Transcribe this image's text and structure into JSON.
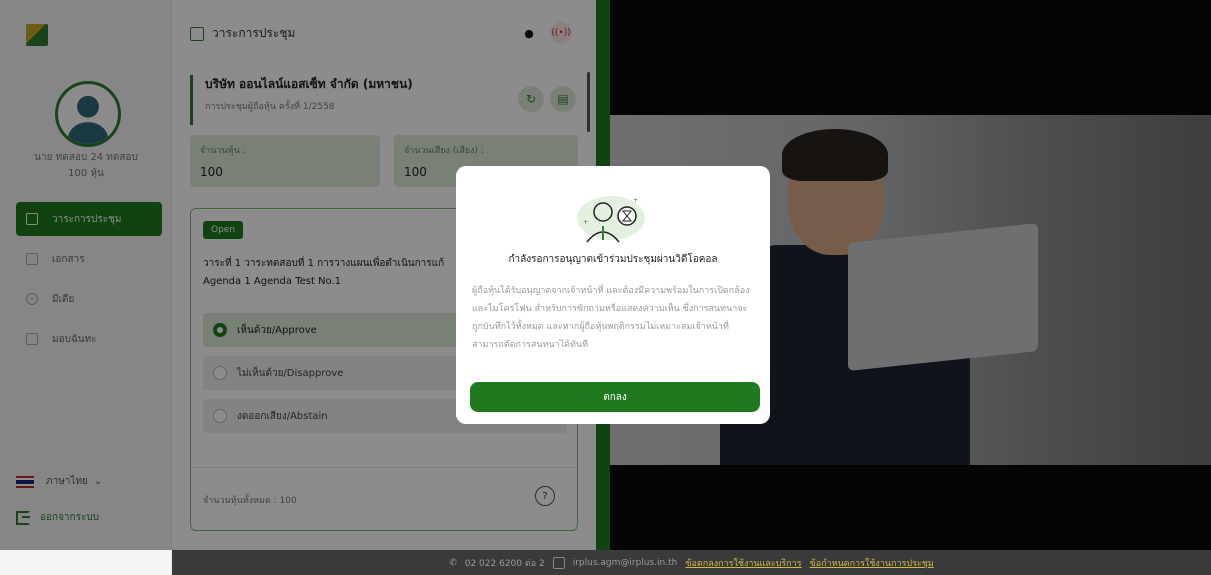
{
  "sidebar": {
    "user_name": "นาย ทดสอบ 24 ทดสอบ",
    "user_shares": "100 หุ้น",
    "nav": [
      {
        "label": "วาระการประชุม",
        "icon": "agenda-icon",
        "active": true
      },
      {
        "label": "เอกสาร",
        "icon": "document-icon",
        "active": false
      },
      {
        "label": "มีเดีย",
        "icon": "media-icon",
        "active": false
      },
      {
        "label": "มอบฉันทะ",
        "icon": "proxy-icon",
        "active": false
      }
    ],
    "language": "ภาษาไทย",
    "logout": "ออกจากระบบ"
  },
  "center": {
    "header_title": "วาระการประชุม",
    "company_name": "บริษัท ออนไลน์แอสเซ็ท จำกัด (มหาชน)",
    "meeting_subtitle": "การประชุมผู้ถือหุ้น ครั้งที่ 1/2558",
    "stats": [
      {
        "label": "จำนวนหุ้น :",
        "value": "100"
      },
      {
        "label": "จำนวนเสียง (เสียง) :",
        "value": "100"
      }
    ],
    "agenda": {
      "status": "Open",
      "title_th": "วาระที่ 1 วาระทดสอบที่ 1 การวางแผนเพื่อดำเนินการแก้",
      "title_en": "Agenda 1 Agenda Test No.1",
      "options": [
        {
          "label": "เห็นด้วย/Approve",
          "selected": true
        },
        {
          "label": "ไม่เห็นด้วย/Disapprove",
          "selected": false
        },
        {
          "label": "งดออกเสียง/Abstain",
          "selected": false
        }
      ],
      "total_shares": "จำนวนหุ้นทั้งหมด : 100"
    }
  },
  "modal": {
    "title": "กำลังรอการอนุญาตเข้าร่วมประชุมผ่านวิดีโอคอล",
    "body": "ผู้ถือหุ้นได้รับอนุญาตจากเจ้าหน้าที่ และต้องมีความพร้อมในการเปิดกล้องและไมโครโฟน สำหรับการซักถามหรือแสดงความเห็น ซึ่งการสนทนาจะถูกบันทึกไว้ทั้งหมด และหากผู้ถือหุ้นพฤติกรรมไม่เหมาะสมเจ้าหน้าที่สามารถตัดการสนทนาได้ทันที",
    "button": "ตกลง"
  },
  "footer": {
    "phone": "02 022 6200 ต่อ 2",
    "email": "irplus.agm@irplus.in.th",
    "link1": "ข้อตกลงการใช้งานและบริการ",
    "link2": "ข้อกำหนดการใช้งานการประชุม"
  },
  "colors": {
    "brand_green": "#1f7a1f",
    "light_green": "#dcebd8",
    "link_gold": "#d4b94a"
  }
}
